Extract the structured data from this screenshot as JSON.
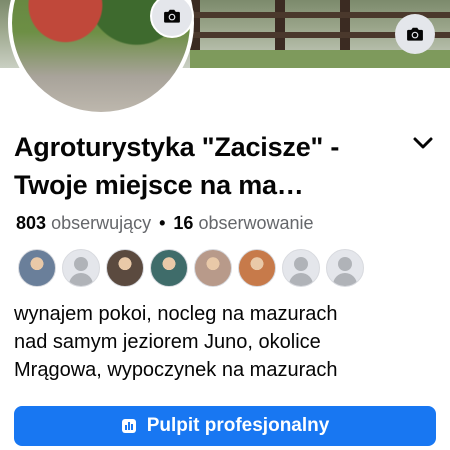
{
  "page": {
    "title_line1": "Agroturystyka \"Zacisze\" -",
    "title_line2": "Twoje miejsce na ma…"
  },
  "stats": {
    "followers_count": "803",
    "followers_label": "obserwujący",
    "separator": "•",
    "following_count": "16",
    "following_label": "obserwowanie"
  },
  "friends": [
    {
      "type": "photo",
      "color": "#6a7f9a"
    },
    {
      "type": "placeholder"
    },
    {
      "type": "photo",
      "color": "#5b4a3f"
    },
    {
      "type": "photo",
      "color": "#3f6c6a"
    },
    {
      "type": "photo",
      "color": "#b89a8a"
    },
    {
      "type": "photo",
      "color": "#c77a4a"
    },
    {
      "type": "placeholder"
    },
    {
      "type": "placeholder"
    }
  ],
  "bio": {
    "line1": "wynajem pokoi, nocleg na mazurach",
    "line2": "nad samym jeziorem Juno, okolice",
    "line3": "Mrągowa, wypoczynek na mazurach"
  },
  "actions": {
    "professional_dashboard_label": "Pulpit profesjonalny"
  },
  "colors": {
    "primary": "#1877f2",
    "secondary_text": "#65676b",
    "icon_bg": "#e4e6eb"
  },
  "icons": {
    "cover_camera": "camera-icon",
    "avatar_camera": "camera-icon",
    "title_dropdown": "chevron-down-icon",
    "dashboard": "dashboard-icon"
  }
}
